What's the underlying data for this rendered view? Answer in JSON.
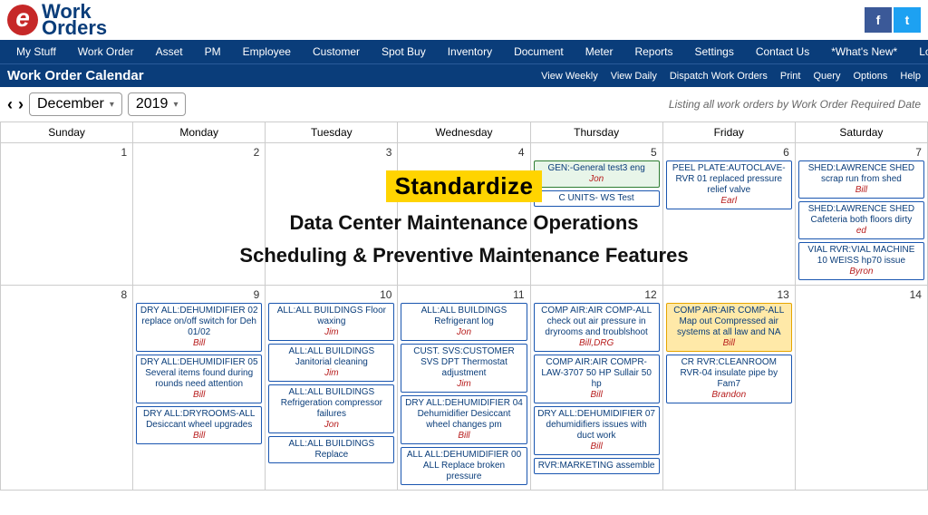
{
  "logo": {
    "brand_top": "Work",
    "brand_bottom": "Orders"
  },
  "social": {
    "facebook": "f",
    "twitter": "t"
  },
  "main_nav": [
    "My Stuff",
    "Work Order",
    "Asset",
    "PM",
    "Employee",
    "Customer",
    "Spot Buy",
    "Inventory",
    "Document",
    "Meter",
    "Reports",
    "Settings",
    "Contact Us",
    "*What's New*",
    "Logout"
  ],
  "subnav": {
    "title": "Work Order Calendar",
    "actions": [
      "View Weekly",
      "View Daily",
      "Dispatch Work Orders",
      "Print",
      "Query",
      "Options",
      "Help"
    ]
  },
  "controls": {
    "prev": "‹",
    "next": "›",
    "month": "December",
    "year": "2019",
    "listing": "Listing all work orders by Work Order Required Date"
  },
  "day_headers": [
    "Sunday",
    "Monday",
    "Tuesday",
    "Wednesday",
    "Thursday",
    "Friday",
    "Saturday"
  ],
  "row1": {
    "dates": [
      "1",
      "2",
      "3",
      "4",
      "5",
      "6",
      "7"
    ],
    "thu": [
      {
        "cls": "green",
        "t": "GEN:-General test3 eng",
        "a": "Jon"
      },
      {
        "cls": "blue",
        "t": "C UNITS- WS Test",
        "a": ""
      }
    ],
    "fri": [
      {
        "cls": "blue",
        "t": "PEEL PLATE:AUTOCLAVE-RVR 01 replaced pressure relief valve",
        "a": "Earl"
      }
    ],
    "sat": [
      {
        "cls": "blue",
        "t": "SHED:LAWRENCE SHED scrap run from shed",
        "a": "Bill"
      },
      {
        "cls": "blue",
        "t": "SHED:LAWRENCE SHED Cafeteria both floors dirty",
        "a": "ed"
      },
      {
        "cls": "blue",
        "t": "VIAL RVR:VIAL MACHINE 10 WEISS hp70 issue",
        "a": "Byron"
      }
    ]
  },
  "row2": {
    "dates": [
      "8",
      "9",
      "10",
      "11",
      "12",
      "13",
      "14"
    ],
    "mon": [
      {
        "cls": "blue",
        "t": "DRY ALL:DEHUMIDIFIER 02 replace on/off switch for Deh 01/02",
        "a": "Bill"
      },
      {
        "cls": "blue",
        "t": "DRY ALL:DEHUMIDIFIER 05 Several items found during rounds need attention",
        "a": "Bill"
      },
      {
        "cls": "blue",
        "t": "DRY ALL:DRYROOMS-ALL Desiccant wheel upgrades",
        "a": "Bill"
      }
    ],
    "tue": [
      {
        "cls": "blue",
        "t": "ALL:ALL BUILDINGS Floor waxing",
        "a": "Jim"
      },
      {
        "cls": "blue",
        "t": "ALL:ALL BUILDINGS Janitorial cleaning",
        "a": "Jim"
      },
      {
        "cls": "blue",
        "t": "ALL:ALL BUILDINGS Refrigeration compressor failures",
        "a": "Jon"
      },
      {
        "cls": "blue",
        "t": "ALL:ALL BUILDINGS Replace",
        "a": ""
      }
    ],
    "wed": [
      {
        "cls": "blue",
        "t": "ALL:ALL BUILDINGS Refrigerant log",
        "a": "Jon"
      },
      {
        "cls": "blue",
        "t": "CUST. SVS:CUSTOMER SVS DPT Thermostat adjustment",
        "a": "Jim"
      },
      {
        "cls": "blue",
        "t": "DRY ALL:DEHUMIDIFIER 04 Dehumidifier Desiccant wheel changes pm",
        "a": "Bill"
      },
      {
        "cls": "blue",
        "t": "ALL ALL:DEHUMIDIFIER 00 ALL Replace broken pressure",
        "a": ""
      }
    ],
    "thu": [
      {
        "cls": "blue",
        "t": "COMP AIR:AIR COMP-ALL check out air pressure in dryrooms and troublshoot",
        "a": "Bill,DRG"
      },
      {
        "cls": "blue",
        "t": "COMP AIR:AIR COMPR-LAW-3707 50 HP Sullair 50 hp",
        "a": "Bill"
      },
      {
        "cls": "blue",
        "t": "DRY ALL:DEHUMIDIFIER 07 dehumidifiers issues with duct work",
        "a": "Bill"
      },
      {
        "cls": "blue",
        "t": "RVR:MARKETING assemble",
        "a": ""
      }
    ],
    "fri": [
      {
        "cls": "orange",
        "t": "COMP AIR:AIR COMP-ALL Map out Compressed air systems at all law and NA",
        "a": "Bill"
      },
      {
        "cls": "blue",
        "t": "CR RVR:CLEANROOM RVR-04 insulate pipe by Fam7",
        "a": "Brandon"
      }
    ]
  },
  "overlay": {
    "highlight": "Standardize",
    "line1": "Data Center Maintenance Operations",
    "line2": "Scheduling & Preventive Maintenance Features"
  }
}
